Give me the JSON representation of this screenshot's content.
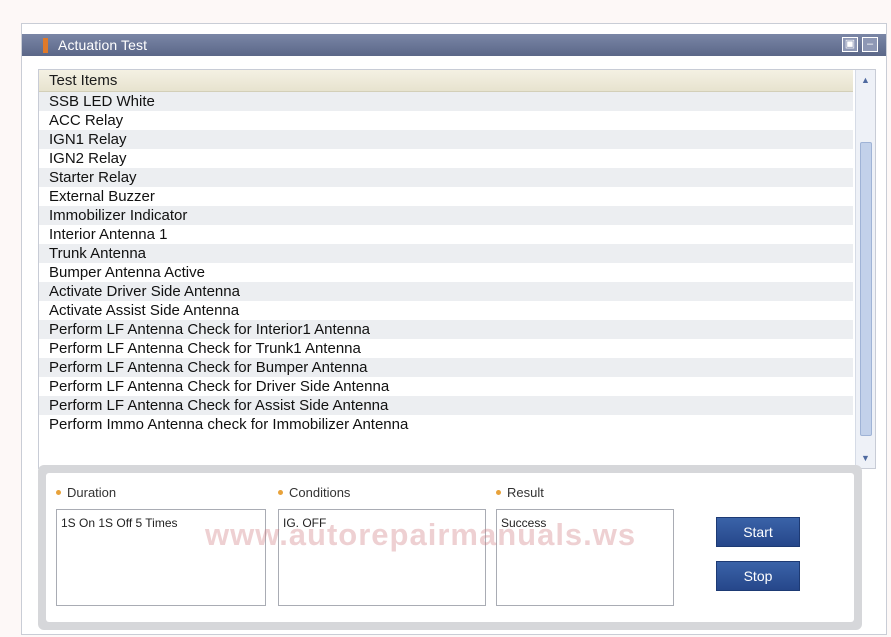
{
  "window": {
    "title": "Actuation Test",
    "controls": [
      "maximize-icon",
      "minimize-icon"
    ]
  },
  "list": {
    "header": "Test Items",
    "items": [
      "SSB LED White",
      "ACC Relay",
      "IGN1 Relay",
      "IGN2 Relay",
      "Starter Relay",
      "External Buzzer",
      "Immobilizer Indicator",
      "Interior Antenna 1",
      "Trunk Antenna",
      "Bumper Antenna Active",
      "Activate Driver Side Antenna",
      "Activate Assist Side Antenna",
      "Perform LF Antenna Check for Interior1 Antenna",
      "Perform LF Antenna Check for Trunk1 Antenna",
      "Perform LF Antenna Check for Bumper Antenna",
      "Perform LF Antenna Check for Driver Side Antenna",
      "Perform LF Antenna Check for Assist Side Antenna",
      "Perform Immo Antenna check for Immobilizer Antenna"
    ]
  },
  "details": {
    "duration_label": "Duration",
    "duration_value": "1S On 1S Off 5 Times",
    "conditions_label": "Conditions",
    "conditions_value": "IG. OFF",
    "result_label": "Result",
    "result_value": "Success"
  },
  "buttons": {
    "start": "Start",
    "stop": "Stop"
  },
  "watermark": "www.autorepairmanuals.ws",
  "colors": {
    "titlebar": "#5b6788",
    "button": "#2f54a0",
    "accent": "#e07a2a"
  }
}
